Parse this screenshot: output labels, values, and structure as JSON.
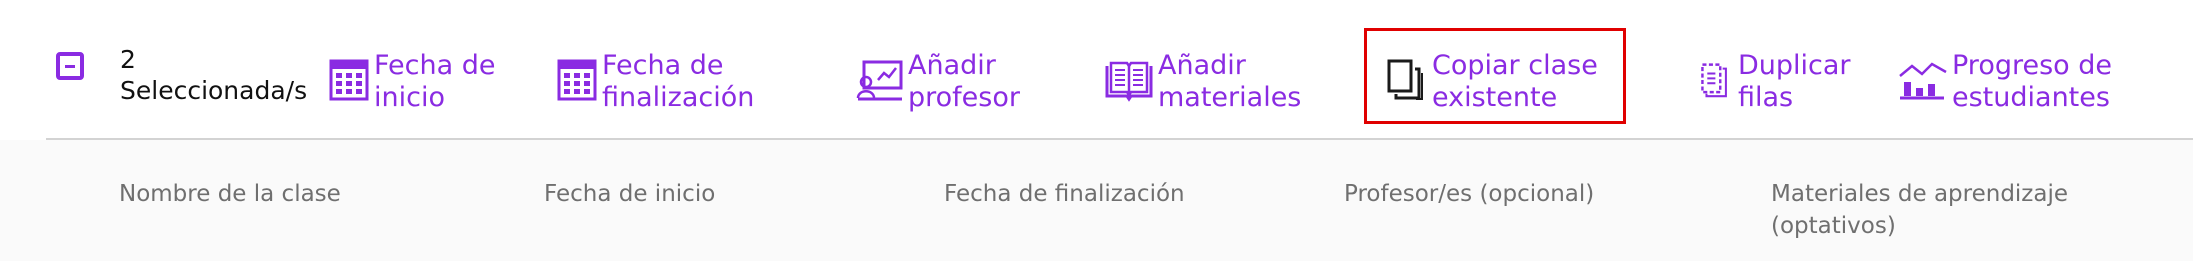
{
  "toolbar": {
    "selection": {
      "count": "2",
      "label": "Seleccionada/s"
    },
    "actions": [
      {
        "label": "Fecha de\ninicio",
        "icon": "calendar-icon"
      },
      {
        "label": "Fecha de\nfinalización",
        "icon": "calendar-icon"
      },
      {
        "label": "Añadir\nprofesor",
        "icon": "teacher-board-icon"
      },
      {
        "label": "Añadir\nmateriales",
        "icon": "open-book-icon"
      },
      {
        "label": "Copiar clase\nexistente",
        "icon": "copy-icon"
      },
      {
        "label": "Duplicar\nfilas",
        "icon": "duplicate-rows-icon"
      },
      {
        "label": "Progreso de\nestudiantes",
        "icon": "progress-chart-icon"
      }
    ],
    "accent_color": "#8a2be2",
    "highlight_color": "#e00000"
  },
  "table": {
    "columns": [
      "Nombre de la clase",
      "Fecha de inicio",
      "Fecha de finalización",
      "Profesor/es (opcional)",
      "Materiales de aprendizaje\n(optativos)"
    ]
  }
}
